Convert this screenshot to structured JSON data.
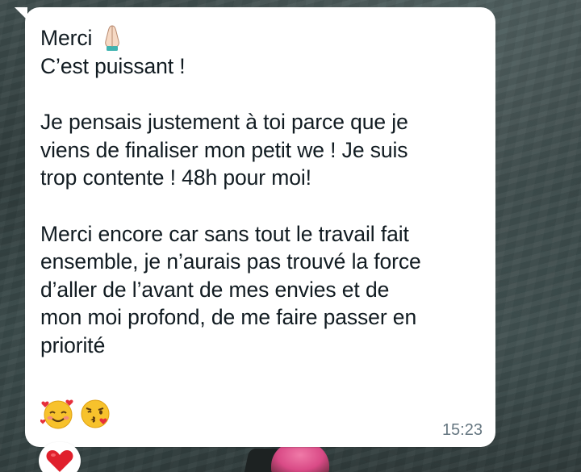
{
  "message": {
    "line1": "Merci",
    "line1_emoji": "folded-hands-icon",
    "line2": "C’est puissant !",
    "paragraph2": [
      "Je pensais justement à toi parce que je",
      "viens de finaliser mon petit we ! Je suis",
      "trop contente ! 48h pour moi!"
    ],
    "paragraph3": [
      "Merci encore car sans tout le travail fait",
      "ensemble, je n’aurais pas trouvé la force",
      "d’aller de l’avant de mes envies et de",
      "mon moi profond, de me faire passer en",
      "priorité"
    ],
    "emojis": [
      "smiling-face-with-hearts-icon",
      "face-blowing-kiss-icon"
    ],
    "time": "15:23"
  },
  "reaction": {
    "emoji": "red-heart-icon"
  },
  "colors": {
    "bubble": "#ffffff",
    "text": "#111b21",
    "timestamp": "#667781",
    "heart": "#e0202c"
  }
}
